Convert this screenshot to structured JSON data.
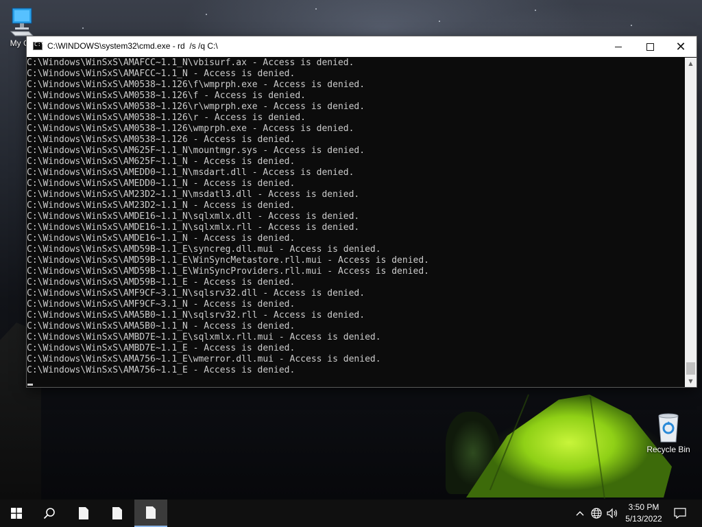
{
  "desktop": {
    "icons": [
      {
        "label": "My Co"
      },
      {
        "label": "Recycle Bin"
      }
    ]
  },
  "window": {
    "title": "C:\\WINDOWS\\system32\\cmd.exe - rd  /s /q C:\\",
    "console_lines": [
      "C:\\Windows\\WinSxS\\AMAFCC~1.1_N\\vbisurf.ax - Access is denied.",
      "C:\\Windows\\WinSxS\\AMAFCC~1.1_N - Access is denied.",
      "C:\\Windows\\WinSxS\\AM0538~1.126\\f\\wmprph.exe - Access is denied.",
      "C:\\Windows\\WinSxS\\AM0538~1.126\\f - Access is denied.",
      "C:\\Windows\\WinSxS\\AM0538~1.126\\r\\wmprph.exe - Access is denied.",
      "C:\\Windows\\WinSxS\\AM0538~1.126\\r - Access is denied.",
      "C:\\Windows\\WinSxS\\AM0538~1.126\\wmprph.exe - Access is denied.",
      "C:\\Windows\\WinSxS\\AM0538~1.126 - Access is denied.",
      "C:\\Windows\\WinSxS\\AM625F~1.1_N\\mountmgr.sys - Access is denied.",
      "C:\\Windows\\WinSxS\\AM625F~1.1_N - Access is denied.",
      "C:\\Windows\\WinSxS\\AMEDD0~1.1_N\\msdart.dll - Access is denied.",
      "C:\\Windows\\WinSxS\\AMEDD0~1.1_N - Access is denied.",
      "C:\\Windows\\WinSxS\\AM23D2~1.1_N\\msdatl3.dll - Access is denied.",
      "C:\\Windows\\WinSxS\\AM23D2~1.1_N - Access is denied.",
      "C:\\Windows\\WinSxS\\AMDE16~1.1_N\\sqlxmlx.dll - Access is denied.",
      "C:\\Windows\\WinSxS\\AMDE16~1.1_N\\sqlxmlx.rll - Access is denied.",
      "C:\\Windows\\WinSxS\\AMDE16~1.1_N - Access is denied.",
      "C:\\Windows\\WinSxS\\AMD59B~1.1_E\\syncreg.dll.mui - Access is denied.",
      "C:\\Windows\\WinSxS\\AMD59B~1.1_E\\WinSyncMetastore.rll.mui - Access is denied.",
      "C:\\Windows\\WinSxS\\AMD59B~1.1_E\\WinSyncProviders.rll.mui - Access is denied.",
      "C:\\Windows\\WinSxS\\AMD59B~1.1_E - Access is denied.",
      "C:\\Windows\\WinSxS\\AMF9CF~3.1_N\\sqlsrv32.dll - Access is denied.",
      "C:\\Windows\\WinSxS\\AMF9CF~3.1_N - Access is denied.",
      "C:\\Windows\\WinSxS\\AMA5B0~1.1_N\\sqlsrv32.rll - Access is denied.",
      "C:\\Windows\\WinSxS\\AMA5B0~1.1_N - Access is denied.",
      "C:\\Windows\\WinSxS\\AMBD7E~1.1_E\\sqlxmlx.rll.mui - Access is denied.",
      "C:\\Windows\\WinSxS\\AMBD7E~1.1_E - Access is denied.",
      "C:\\Windows\\WinSxS\\AMA756~1.1_E\\wmerror.dll.mui - Access is denied.",
      "C:\\Windows\\WinSxS\\AMA756~1.1_E - Access is denied."
    ],
    "icon": "cmd-icon",
    "buttons": {
      "minimize": "minimize-icon",
      "maximize": "maximize-icon",
      "close": "close-icon"
    }
  },
  "taskbar": {
    "start_icon": "windows-logo-icon",
    "search_icon": "search-icon",
    "pinned": [
      "document-icon",
      "document-icon",
      "document-icon"
    ],
    "tray": {
      "chevron_icon": "chevron-up-icon",
      "network_icon": "globe-icon",
      "volume_icon": "speaker-icon"
    },
    "clock": {
      "time": "3:50 PM",
      "date": "5/13/2022"
    },
    "notification_icon": "notification-icon"
  }
}
